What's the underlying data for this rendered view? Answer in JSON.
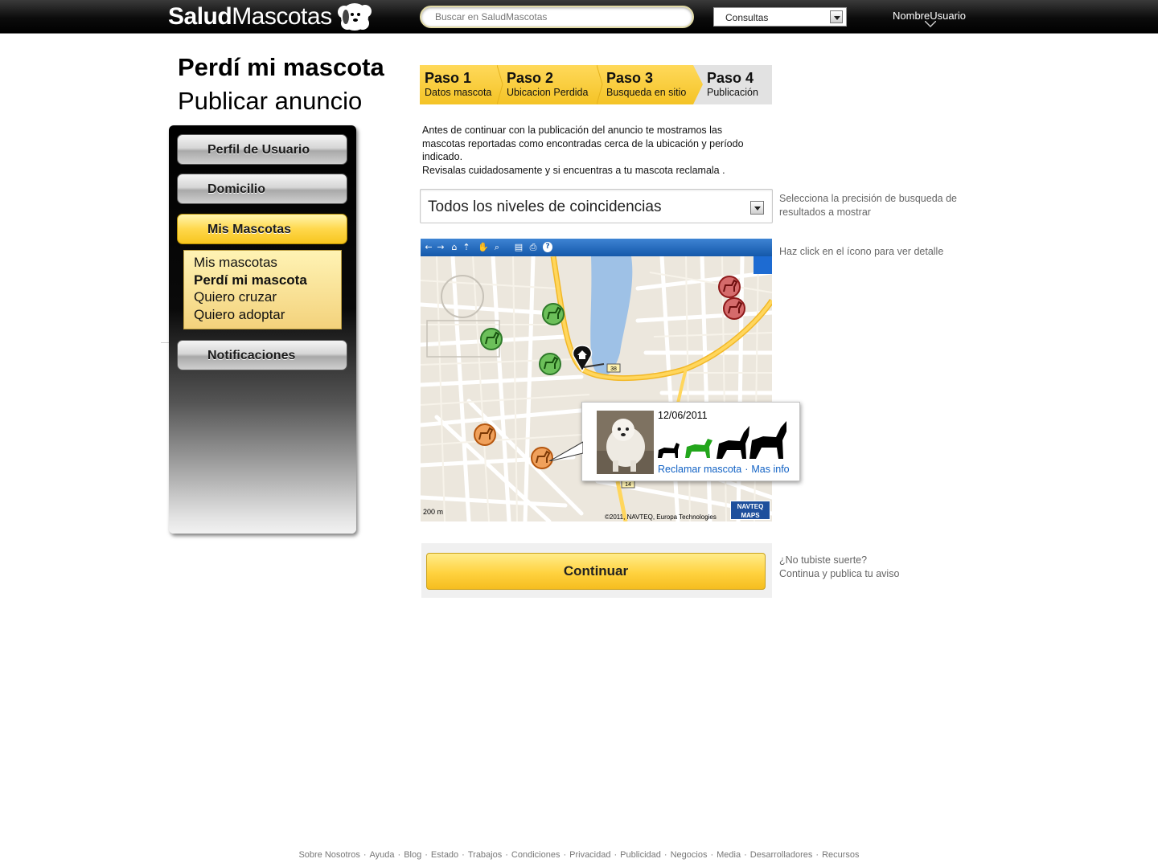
{
  "header": {
    "logo_bold": "Salud",
    "logo_light": "Mascotas",
    "search_placeholder": "Buscar en SaludMascotas",
    "category_selected": "Consultas",
    "username": "NombreUsuario"
  },
  "page": {
    "title": "Perdí mi mascota",
    "subtitle": "Publicar anuncio"
  },
  "sidebar": {
    "items": [
      {
        "label": "Perfil de Usuario"
      },
      {
        "label": "Domicilio"
      },
      {
        "label": "Mis Mascotas"
      },
      {
        "label": "Notificaciones"
      }
    ],
    "submenu": [
      {
        "label": "Mis mascotas"
      },
      {
        "label": "Perdí mi mascota"
      },
      {
        "label": "Quiero cruzar"
      },
      {
        "label": "Quiero adoptar"
      }
    ]
  },
  "steps": [
    {
      "number": "Paso 1",
      "label": "Datos mascota"
    },
    {
      "number": "Paso 2",
      "label": "Ubicacion Perdida"
    },
    {
      "number": "Paso 3",
      "label": "Busqueda en sitio"
    },
    {
      "number": "Paso 4",
      "label": "Publicación"
    }
  ],
  "intro": {
    "line1": "Antes de continuar con la publicación del anuncio te mostramos las mascotas reportadas como encontradas cerca de la ubicación y período indicado.",
    "line2": "Revisalas cuidadosamente y si encuentras a tu mascota reclamala ."
  },
  "filter": {
    "selected": "Todos los niveles de coincidencias",
    "hint": "Selecciona la precisión de busqueda de resultados a mostrar"
  },
  "map": {
    "hint": "Haz click en el ícono para ver detalle",
    "scale": "200 m",
    "copyright": "©2011, NAVTEQ, Europa Technologies",
    "provider_line1": "NAVTEQ",
    "provider_line2": "MAPS",
    "road_number_1": "38",
    "road_number_2": "14"
  },
  "popup": {
    "date": "12/06/2011",
    "claim_link": "Reclamar mascota",
    "separator": "·",
    "info_link": "Mas info"
  },
  "continue": {
    "label": "Continuar",
    "hint_line1": "¿No tubiste suerte?",
    "hint_line2": "Continua y publica tu aviso"
  },
  "footer": {
    "links": [
      "Sobre Nosotros",
      "Ayuda",
      "Blog",
      "Estado",
      "Trabajos",
      "Condiciones",
      "Privacidad",
      "Publicidad",
      "Negocios",
      "Media",
      "Desarrolladores",
      "Recursos"
    ],
    "separator": "·"
  },
  "colors": {
    "accent_yellow": "#ffd23f",
    "link_blue": "#1061c4",
    "marker_green": "#3aa43a",
    "marker_red": "#c0262b",
    "marker_orange": "#e2761e"
  }
}
